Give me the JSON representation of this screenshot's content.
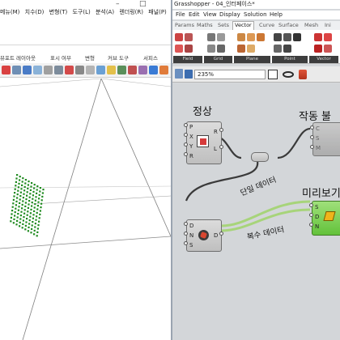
{
  "left_window": {
    "win_buttons": [
      "–",
      "□"
    ],
    "menu": [
      "메뉴(M)",
      "치수(D)",
      "변형(T)",
      "도구(L)",
      "분석(A)",
      "렌더링(R)",
      "패널(P)"
    ],
    "tabs": [
      "뷰포트 레이아웃",
      "표시 여부",
      "변형",
      "커브 도구",
      "서피스"
    ]
  },
  "gh": {
    "title": "Grasshopper - 04_인터페이스*",
    "menu": [
      "File",
      "Edit",
      "View",
      "Display",
      "Solution",
      "Help"
    ],
    "tabs": [
      "Params",
      "Maths",
      "Sets",
      "Vector",
      "Curve",
      "Surface",
      "Mesh",
      "Ini"
    ],
    "active_tab": "Vector",
    "panels": [
      "Field",
      "Grid",
      "Plane",
      "Point",
      "Vector"
    ],
    "zoom": "235%"
  },
  "canvas": {
    "labels": {
      "top_left": "정상",
      "top_right": "작동 불",
      "mid_right": "미리보기",
      "single_data": "단일 데이터",
      "multi_data": "복수 데이터"
    },
    "comp1_inputs": [
      "P",
      "X",
      "Y",
      "R"
    ],
    "comp1_outputs": [
      "R",
      "L"
    ],
    "comp2_inputs": [
      "C",
      "S",
      "M"
    ],
    "comp3_inputs": [
      "D",
      "N",
      "S"
    ],
    "comp3_outputs": [
      "D"
    ],
    "comp4_inputs": [
      "S",
      "D",
      "N"
    ]
  },
  "colors": {
    "accent_green": "#1f8a1f",
    "wire_green": "#a7d47a",
    "wire_dark": "#3a3a3a",
    "yellow_highlight": "#e8dc3a"
  }
}
